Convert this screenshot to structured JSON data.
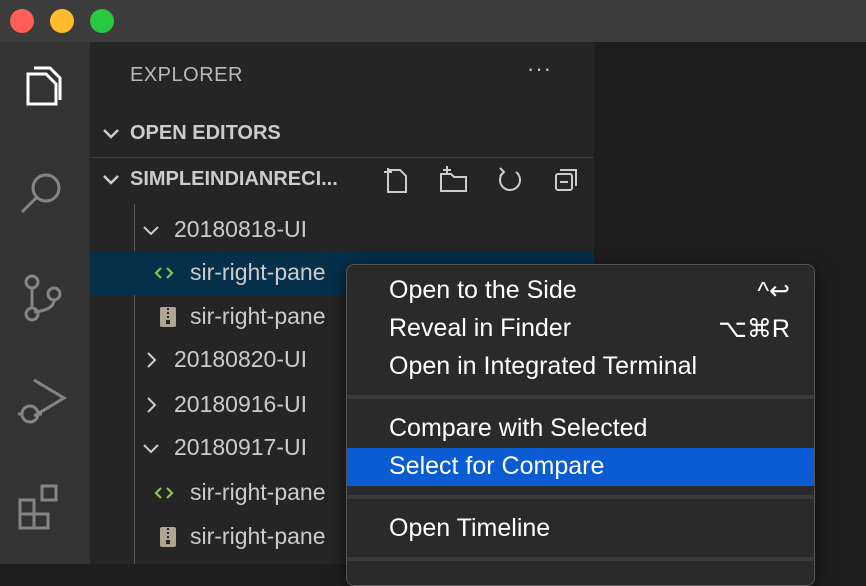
{
  "window": {
    "controls": [
      {
        "name": "close",
        "color": "#ff5f57"
      },
      {
        "name": "minimize",
        "color": "#febc2e"
      },
      {
        "name": "zoom",
        "color": "#28c840"
      }
    ]
  },
  "activity_bar": {
    "items": [
      "explorer-icon",
      "search-icon",
      "source-control-icon",
      "run-debug-icon",
      "extensions-icon"
    ]
  },
  "sidebar": {
    "title": "EXPLORER",
    "more": "···",
    "sections": {
      "open_editors": "OPEN EDITORS",
      "workspace": "SIMPLEINDIANRECI..."
    },
    "workspace_actions": [
      "new-file-icon",
      "new-folder-icon",
      "refresh-icon",
      "collapse-all-icon"
    ],
    "tree": [
      {
        "label": "20180818-UI",
        "type": "folder",
        "expanded": true
      },
      {
        "label": "sir-right-pane",
        "type": "file-code",
        "selected": true
      },
      {
        "label": "sir-right-pane",
        "type": "file-zip"
      },
      {
        "label": "20180820-UI",
        "type": "folder",
        "expanded": false
      },
      {
        "label": "20180916-UI",
        "type": "folder",
        "expanded": false
      },
      {
        "label": "20180917-UI",
        "type": "folder",
        "expanded": true
      },
      {
        "label": "sir-right-pane",
        "type": "file-code"
      },
      {
        "label": "sir-right-pane",
        "type": "file-zip"
      }
    ]
  },
  "context_menu": {
    "items": [
      {
        "label": "Open to the Side",
        "shortcut": "^↩"
      },
      {
        "label": "Reveal in Finder",
        "shortcut": "⌥⌘R"
      },
      {
        "label": "Open in Integrated Terminal",
        "shortcut": ""
      },
      {
        "label": "Compare with Selected",
        "shortcut": ""
      },
      {
        "label": "Select for Compare",
        "shortcut": "",
        "highlighted": true
      },
      {
        "label": "Open Timeline",
        "shortcut": ""
      }
    ]
  },
  "colors": {
    "accent": "#0b5bd3",
    "selection": "#062f4a",
    "code_icon": "#8dc149",
    "zip_icon": "#b0a593"
  }
}
